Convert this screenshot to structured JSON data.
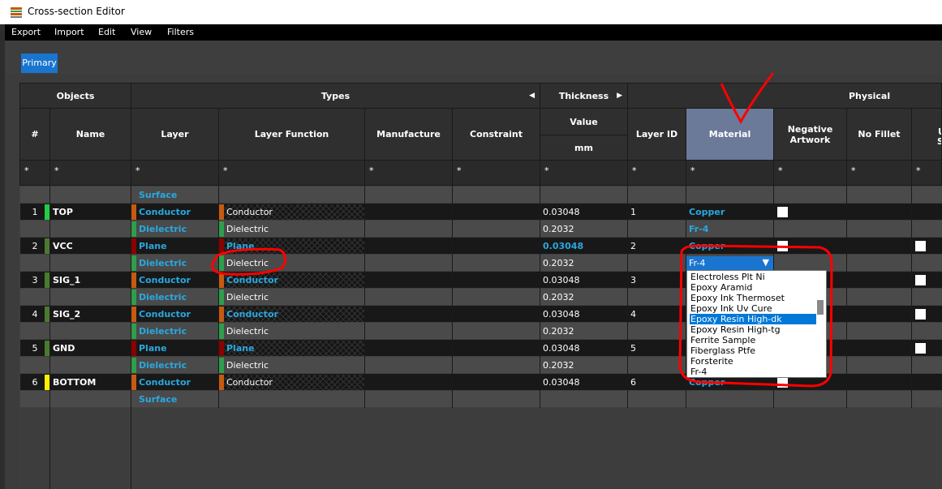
{
  "window": {
    "title": "Cross-section Editor"
  },
  "menu": [
    "Export",
    "Import",
    "Edit",
    "View",
    "Filters"
  ],
  "tabs": {
    "primary": "Primary"
  },
  "headers": {
    "groups": {
      "objects": "Objects",
      "types": "Types",
      "thickness": "Thickness",
      "physical": "Physical"
    },
    "columns": {
      "num": "#",
      "name": "Name",
      "layer": "Layer",
      "layer_function": "Layer Function",
      "manufacture": "Manufacture",
      "constraint": "Constraint",
      "value": "Value",
      "unit": "mm",
      "layer_id": "Layer ID",
      "material": "Material",
      "negative_artwork": "Negative Artwork",
      "no_fillet": "No Fillet",
      "partial_u": "U",
      "partial_s": "S"
    },
    "filter": "*"
  },
  "rows": [
    {
      "num": "",
      "name": "",
      "layer": "Surface",
      "layer_func": "",
      "value": "",
      "layer_id": "",
      "material": ""
    },
    {
      "num": "1",
      "name": "TOP",
      "layer": "Conductor",
      "layer_func": "Conductor",
      "value": "0.03048",
      "layer_id": "1",
      "material": "Copper"
    },
    {
      "num": "",
      "name": "",
      "layer": "Dielectric",
      "layer_func": "Dielectric",
      "value": "0.2032",
      "layer_id": "",
      "material": "Fr-4"
    },
    {
      "num": "2",
      "name": "VCC",
      "layer": "Plane",
      "layer_func": "Plane",
      "value": "0.03048",
      "layer_id": "2",
      "material": "Copper"
    },
    {
      "num": "",
      "name": "",
      "layer": "Dielectric",
      "layer_func": "Dielectric",
      "value": "0.2032",
      "layer_id": "",
      "material": "Fr-4"
    },
    {
      "num": "3",
      "name": "SIG_1",
      "layer": "Conductor",
      "layer_func": "Conductor",
      "value": "0.03048",
      "layer_id": "3",
      "material": ""
    },
    {
      "num": "",
      "name": "",
      "layer": "Dielectric",
      "layer_func": "Dielectric",
      "value": "0.2032",
      "layer_id": "",
      "material": ""
    },
    {
      "num": "4",
      "name": "SIG_2",
      "layer": "Conductor",
      "layer_func": "Conductor",
      "value": "0.03048",
      "layer_id": "4",
      "material": ""
    },
    {
      "num": "",
      "name": "",
      "layer": "Dielectric",
      "layer_func": "Dielectric",
      "value": "0.2032",
      "layer_id": "",
      "material": ""
    },
    {
      "num": "5",
      "name": "GND",
      "layer": "Plane",
      "layer_func": "Plane",
      "value": "0.03048",
      "layer_id": "5",
      "material": ""
    },
    {
      "num": "",
      "name": "",
      "layer": "Dielectric",
      "layer_func": "Dielectric",
      "value": "0.2032",
      "layer_id": "",
      "material": ""
    },
    {
      "num": "6",
      "name": "BOTTOM",
      "layer": "Conductor",
      "layer_func": "Conductor",
      "value": "0.03048",
      "layer_id": "6",
      "material": "Copper"
    },
    {
      "num": "",
      "name": "",
      "layer": "Surface",
      "layer_func": "",
      "value": "",
      "layer_id": "",
      "material": ""
    }
  ],
  "dropdown": {
    "selected": "Fr-4",
    "options": [
      "Electroless Plt Ni",
      "Epoxy Aramid",
      "Epoxy Ink Thermoset",
      "Epoxy Ink Uv Cure",
      "Epoxy Resin High-dk",
      "Epoxy Resin High-tg",
      "Ferrite Sample",
      "Fiberglass Ptfe",
      "Forsterite",
      "Fr-4"
    ],
    "highlighted": "Epoxy Resin High-dk"
  },
  "colors": {
    "conductor": "#c55a11",
    "plane": "#8b0000",
    "dielectric": "#2e9e4a",
    "name_top": "#22cc44",
    "name_mid": "#4a7a2e",
    "name_bottom": "#ffee00",
    "accent_blue": "#29a8e0",
    "annotation_red": "#ff0000"
  }
}
